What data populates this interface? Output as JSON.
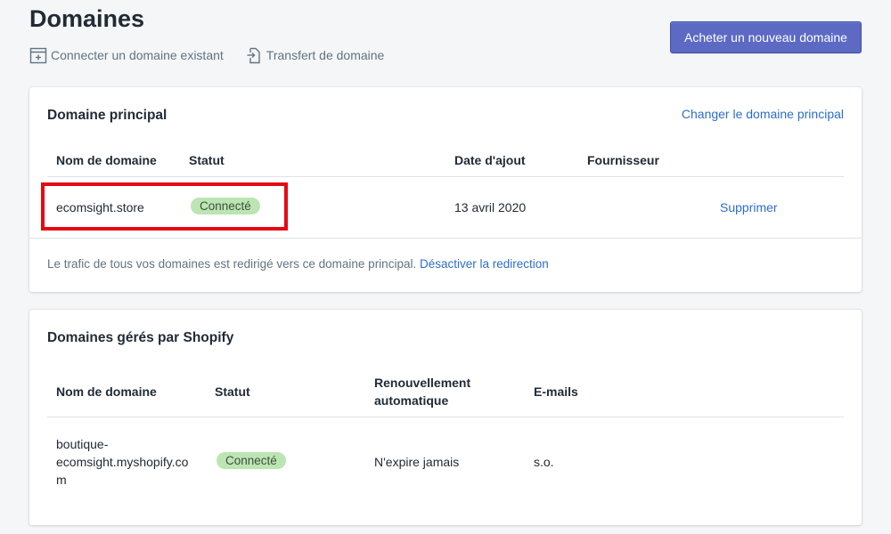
{
  "page": {
    "title": "Domaines",
    "actions": [
      {
        "label": "Connecter un domaine existant",
        "icon": "connect-domain-icon"
      },
      {
        "label": "Transfert de domaine",
        "icon": "transfer-domain-icon"
      }
    ],
    "primary_button": "Acheter un nouveau domaine",
    "accent_color": "#5c6ac4"
  },
  "primary_domain": {
    "title": "Domaine principal",
    "change_link": "Changer le domaine principal",
    "columns": [
      "Nom de domaine",
      "Statut",
      "Date d'ajout",
      "Fournisseur"
    ],
    "row": {
      "name": "ecomsight.store",
      "status": "Connecté",
      "date": "13 avril 2020",
      "provider": "",
      "action": "Supprimer"
    },
    "footer": {
      "text": "Le trafic de tous vos domaines est redirigé vers ce domaine principal.",
      "link": "Désactiver la redirection"
    },
    "highlight_color": "#e50914"
  },
  "shopify_domains": {
    "title": "Domaines gérés par Shopify",
    "columns": {
      "name": "Nom de domaine",
      "status": "Statut",
      "renewal_line1": "Renouvellement",
      "renewal_line2": "automatique",
      "emails": "E-mails"
    },
    "row": {
      "name_line1": "boutique-",
      "name_line2": "ecomsight.myshopify.co",
      "name_line3": "m",
      "status": "Connecté",
      "renewal": "N'expire jamais",
      "emails": "s.o."
    }
  }
}
